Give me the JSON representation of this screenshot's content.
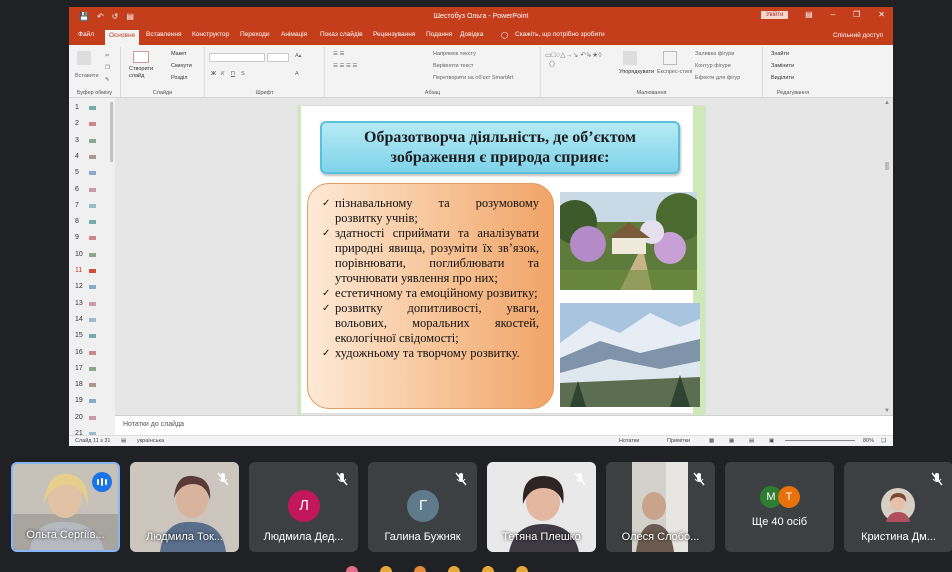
{
  "powerpoint": {
    "window_title": "Шестобуз Ольга - PowerPoint",
    "signin_label": "Увійти",
    "tabs": [
      "Файл",
      "Основне",
      "Вставлення",
      "Конструктор",
      "Переходи",
      "Анімація",
      "Показ слайдів",
      "Рецензування",
      "Подання",
      "Довідка"
    ],
    "tell_me": "Скажіть, що потрібно зробити",
    "share": "Спільний доступ",
    "ribbon": {
      "clipboard": {
        "paste": "Вставити",
        "label": "Буфер обміну"
      },
      "slides": {
        "new_slide": "Створити слайд",
        "layout": "Макет",
        "reset": "Скинути",
        "section": "Розділ",
        "label": "Слайди"
      },
      "font": {
        "label": "Шрифт",
        "bold": "Ж",
        "italic": "К",
        "underline": "П",
        "strike": "S"
      },
      "paragraph": {
        "label": "Абзац",
        "text_direction": "Напрямок тексту",
        "align_text": "Вирівняти текст",
        "smartart": "Перетворити на об'єкт SmartArt"
      },
      "drawing": {
        "label": "Малювання",
        "arrange": "Упорядкувати",
        "quick_styles": "Експрес-стилі",
        "fill": "Заливка фігури",
        "outline": "Контур фігури",
        "effects": "Ефекти для фігур"
      },
      "editing": {
        "label": "Редагування",
        "find": "Знайти",
        "replace": "Замінити",
        "select": "Виділити"
      }
    },
    "thumbnails": [
      "1",
      "2",
      "3",
      "4",
      "5",
      "6",
      "7",
      "8",
      "9",
      "10",
      "11",
      "12",
      "13",
      "14",
      "15",
      "16",
      "17",
      "18",
      "19",
      "20",
      "21"
    ],
    "active_slide_index": 11,
    "slide": {
      "title": "Образотворча діяльність, де об’єктом зображення є природа сприяє:",
      "bullets": [
        "пізнавальному та розумовому розвитку учнів;",
        "здатності сприймати та аналізувати природні явища, розуміти їх зв’язок, порівнювати, поглиблювати та уточнювати уявлення про них;",
        "естетичному та емоційному розвитку;",
        "розвитку допитливості, уваги, вольових, моральних якостей, екологічної свідомості;",
        "художньому та творчому розвитку."
      ]
    },
    "notes_placeholder": "Нотатки до слайда",
    "status": {
      "slide_counter": "Слайд 11 з 31",
      "language": "українська",
      "notes": "Нотатки",
      "comments": "Примітки",
      "zoom": "80%"
    }
  },
  "meeting": {
    "participants": [
      {
        "name": "Ольга Сергіїв...",
        "speaking": true
      },
      {
        "name": "Людмила Ток...",
        "muted": true
      },
      {
        "name": "Людмила Дед...",
        "muted": true,
        "initial": "Л",
        "color": "#c2185b"
      },
      {
        "name": "Галина Бужняк",
        "muted": true,
        "initial": "Г",
        "color": "#5f7a8a"
      },
      {
        "name": "Тетяна Плешко",
        "muted": true
      },
      {
        "name": "Олеся Слобо...",
        "muted": true
      },
      {
        "name": "Ще 40 осіб",
        "initials": [
          "М",
          "Т"
        ],
        "colors": [
          "#2e7d32",
          "#e8710a"
        ]
      },
      {
        "name": "Кристина Дм...",
        "muted": true
      }
    ]
  }
}
